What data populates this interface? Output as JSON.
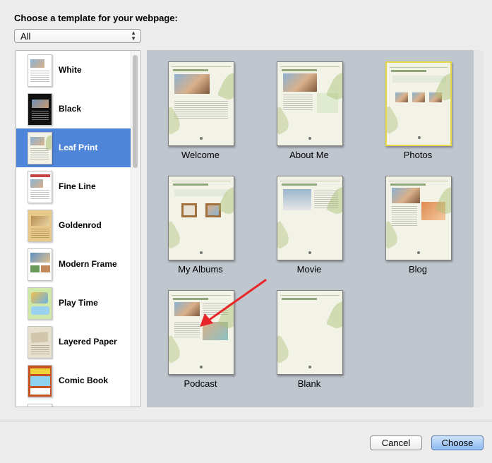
{
  "dialog": {
    "title": "Choose a template for your webpage:",
    "filter": {
      "selected": "All"
    }
  },
  "sidebar": {
    "selected_index": 2,
    "items": [
      {
        "label": "White"
      },
      {
        "label": "Black"
      },
      {
        "label": "Leaf Print"
      },
      {
        "label": "Fine Line"
      },
      {
        "label": "Goldenrod"
      },
      {
        "label": "Modern Frame"
      },
      {
        "label": "Play Time"
      },
      {
        "label": "Layered Paper"
      },
      {
        "label": "Comic Book"
      }
    ]
  },
  "templates": {
    "selected_index": 2,
    "items": [
      {
        "label": "Welcome"
      },
      {
        "label": "About Me"
      },
      {
        "label": "Photos"
      },
      {
        "label": "My Albums"
      },
      {
        "label": "Movie"
      },
      {
        "label": "Blog"
      },
      {
        "label": "Podcast"
      },
      {
        "label": "Blank"
      }
    ]
  },
  "buttons": {
    "cancel": "Cancel",
    "choose": "Choose"
  },
  "colors": {
    "selection": "#4f85d9",
    "grid_background": "#c0c6ce",
    "annotation_arrow": "#e8262a",
    "selected_template_border": "#e6d84a"
  }
}
